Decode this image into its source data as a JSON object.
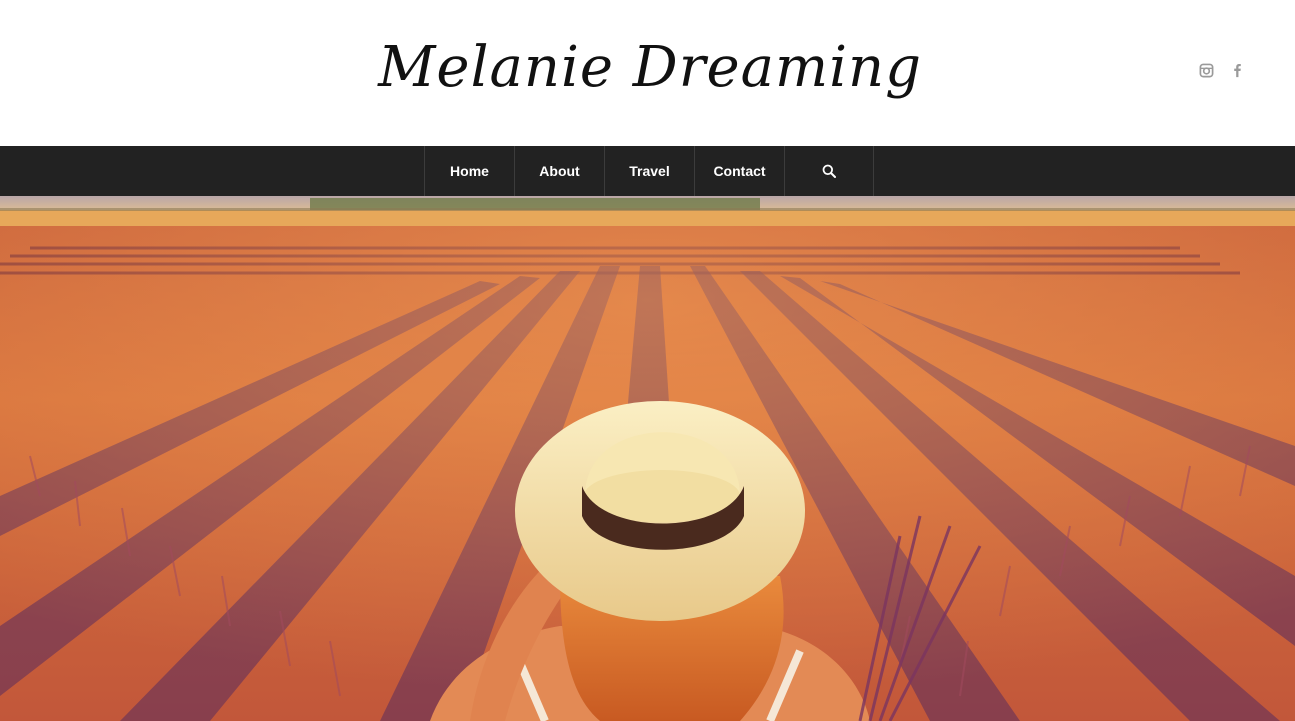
{
  "site": {
    "title": "Melanie Dreaming"
  },
  "header": {
    "social": [
      {
        "icon": "instagram-icon"
      },
      {
        "icon": "facebook-icon"
      }
    ]
  },
  "nav": {
    "items": [
      {
        "label": "Home"
      },
      {
        "label": "About"
      },
      {
        "label": "Travel"
      },
      {
        "label": "Contact"
      }
    ],
    "search_icon": "search-icon"
  },
  "hero": {
    "image": "lavender-field-woman-in-straw-hat",
    "colors": {
      "sky": "#e8c89a",
      "field": "#d9753f",
      "shadow": "#5a2c6a",
      "hat": "#f3e1a8",
      "hat_band": "#4a2a1e"
    }
  },
  "colors": {
    "nav_bg": "#222222",
    "nav_text": "#ffffff",
    "icon": "#999999"
  }
}
